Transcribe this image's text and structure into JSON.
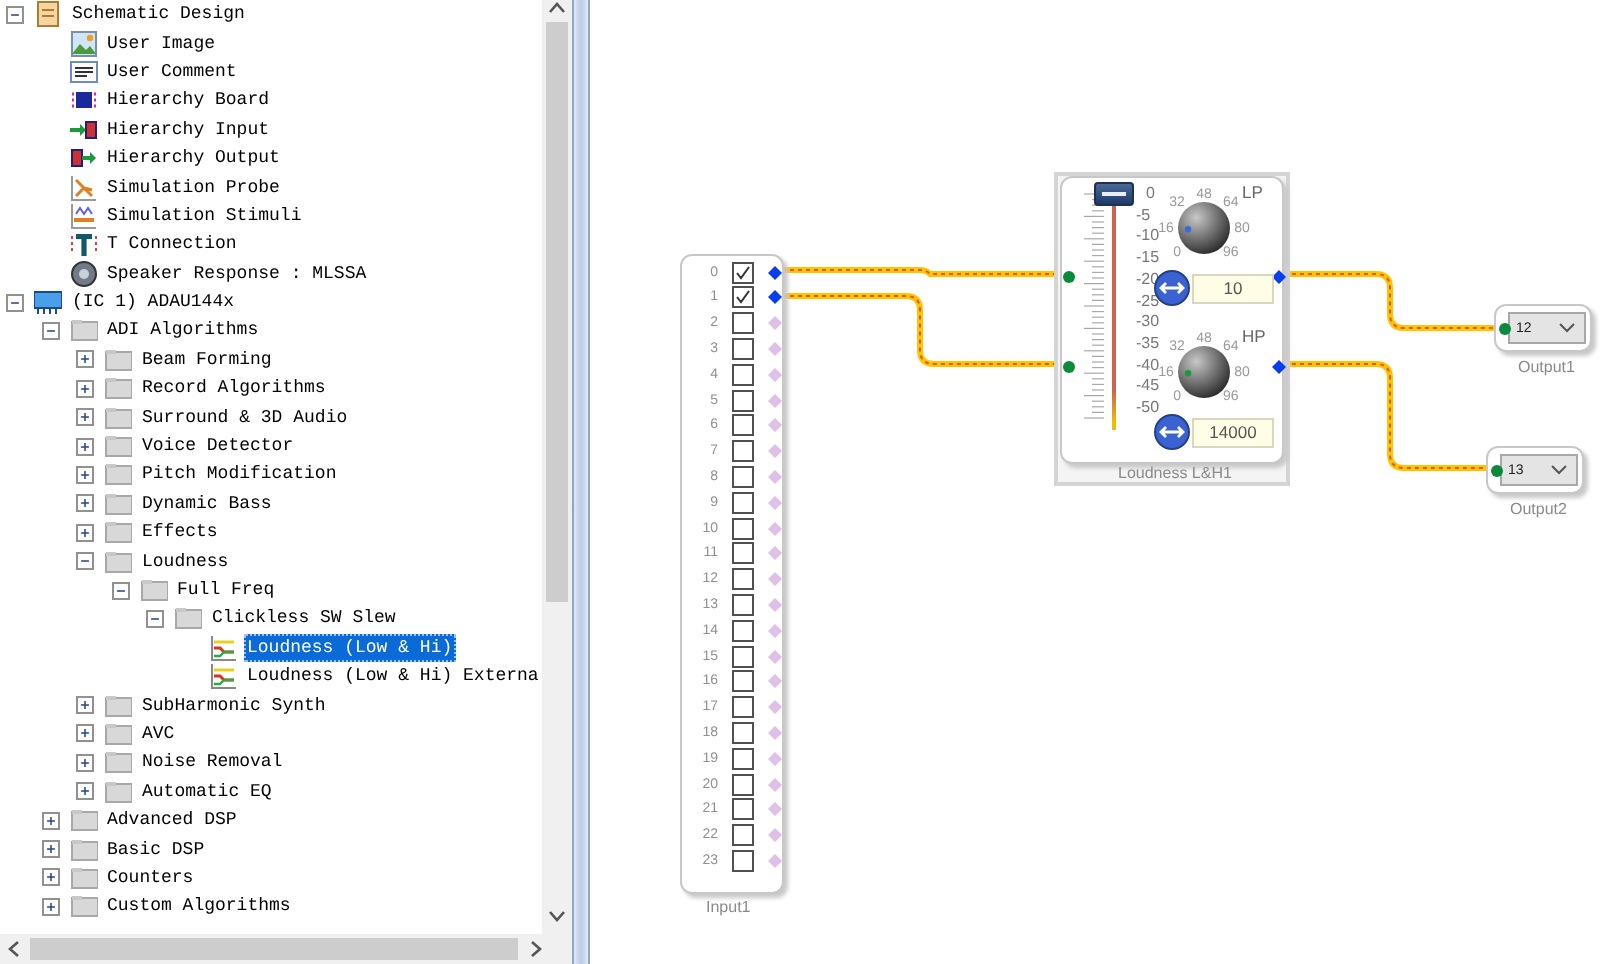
{
  "tree": [
    {
      "label": "Schematic Design",
      "kind": "schematic",
      "expanded": true,
      "selected": false,
      "children": [
        {
          "label": "User Image",
          "kind": "image",
          "selected": false
        },
        {
          "label": "User Comment",
          "kind": "comment",
          "selected": false
        },
        {
          "label": "Hierarchy Board",
          "kind": "board",
          "selected": false
        },
        {
          "label": "Hierarchy Input",
          "kind": "input",
          "selected": false
        },
        {
          "label": "Hierarchy Output",
          "kind": "output",
          "selected": false
        },
        {
          "label": "Simulation Probe",
          "kind": "probe",
          "selected": false
        },
        {
          "label": "Simulation Stimuli",
          "kind": "stimuli",
          "selected": false
        },
        {
          "label": "T Connection",
          "kind": "tconn",
          "selected": false
        },
        {
          "label": "Speaker Response : MLSSA",
          "kind": "speaker",
          "selected": false
        }
      ]
    },
    {
      "label": "(IC 1) ADAU144x",
      "kind": "chip",
      "expanded": true,
      "selected": false,
      "children": [
        {
          "label": "ADI Algorithms",
          "kind": "folder",
          "expanded": true,
          "selected": false,
          "children": [
            {
              "label": "Beam Forming",
              "kind": "folder",
              "expanded": false,
              "selected": false
            },
            {
              "label": "Record Algorithms",
              "kind": "folder",
              "expanded": false,
              "selected": false
            },
            {
              "label": "Surround & 3D Audio",
              "kind": "folder",
              "expanded": false,
              "selected": false
            },
            {
              "label": "Voice Detector",
              "kind": "folder",
              "expanded": false,
              "selected": false
            },
            {
              "label": "Pitch Modification",
              "kind": "folder",
              "expanded": false,
              "selected": false
            },
            {
              "label": "Dynamic Bass",
              "kind": "folder",
              "expanded": false,
              "selected": false
            },
            {
              "label": "Effects",
              "kind": "folder",
              "expanded": false,
              "selected": false
            },
            {
              "label": "Loudness",
              "kind": "folder",
              "expanded": true,
              "selected": false,
              "children": [
                {
                  "label": "Full Freq",
                  "kind": "folder",
                  "expanded": true,
                  "selected": false,
                  "children": [
                    {
                      "label": "Clickless SW Slew",
                      "kind": "folder",
                      "expanded": true,
                      "selected": false,
                      "children": [
                        {
                          "label": "Loudness (Low & Hi)",
                          "kind": "algorithm",
                          "selected": true
                        },
                        {
                          "label": "Loudness (Low & Hi) Externa",
                          "kind": "algorithm",
                          "selected": false
                        }
                      ]
                    }
                  ]
                }
              ]
            },
            {
              "label": "SubHarmonic Synth",
              "kind": "folder",
              "expanded": false,
              "selected": false
            },
            {
              "label": "AVC",
              "kind": "folder",
              "expanded": false,
              "selected": false
            },
            {
              "label": "Noise Removal",
              "kind": "folder",
              "expanded": false,
              "selected": false
            },
            {
              "label": "Automatic EQ",
              "kind": "folder",
              "expanded": false,
              "selected": false
            }
          ]
        },
        {
          "label": "Advanced DSP",
          "kind": "folder",
          "expanded": false,
          "selected": false
        },
        {
          "label": "Basic DSP",
          "kind": "folder",
          "expanded": false,
          "selected": false
        },
        {
          "label": "Counters",
          "kind": "folder",
          "expanded": false,
          "selected": false
        },
        {
          "label": "Custom Algorithms",
          "kind": "folder",
          "expanded": false,
          "selected": false
        }
      ]
    }
  ],
  "input_block": {
    "title": "Input1",
    "channels": [
      {
        "label": "0",
        "checked": true,
        "connected": true
      },
      {
        "label": "1",
        "checked": true,
        "connected": true
      },
      {
        "label": "2",
        "checked": false,
        "connected": false
      },
      {
        "label": "3",
        "checked": false,
        "connected": false
      },
      {
        "label": "4",
        "checked": false,
        "connected": false
      },
      {
        "label": "5",
        "checked": false,
        "connected": false
      },
      {
        "label": "6",
        "checked": false,
        "connected": false
      },
      {
        "label": "7",
        "checked": false,
        "connected": false
      },
      {
        "label": "8",
        "checked": false,
        "connected": false
      },
      {
        "label": "9",
        "checked": false,
        "connected": false
      },
      {
        "label": "10",
        "checked": false,
        "connected": false
      },
      {
        "label": "11",
        "checked": false,
        "connected": false
      },
      {
        "label": "12",
        "checked": false,
        "connected": false
      },
      {
        "label": "13",
        "checked": false,
        "connected": false
      },
      {
        "label": "14",
        "checked": false,
        "connected": false
      },
      {
        "label": "15",
        "checked": false,
        "connected": false
      },
      {
        "label": "16",
        "checked": false,
        "connected": false
      },
      {
        "label": "17",
        "checked": false,
        "connected": false
      },
      {
        "label": "18",
        "checked": false,
        "connected": false
      },
      {
        "label": "19",
        "checked": false,
        "connected": false
      },
      {
        "label": "20",
        "checked": false,
        "connected": false
      },
      {
        "label": "21",
        "checked": false,
        "connected": false
      },
      {
        "label": "22",
        "checked": false,
        "connected": false
      },
      {
        "label": "23",
        "checked": false,
        "connected": false
      }
    ]
  },
  "loudness_block": {
    "title": "Loudness L&H1",
    "slider": {
      "level": 1,
      "scale": [
        "0",
        "-5",
        "-10",
        "-15",
        "-20",
        "-25",
        "-30",
        "-35",
        "-40",
        "-45",
        "-50"
      ]
    },
    "knobs": [
      {
        "label": "LP",
        "scale": [
          "0",
          "16",
          "32",
          "48",
          "64",
          "80",
          "96"
        ],
        "value": "10"
      },
      {
        "label": "HP",
        "scale": [
          "0",
          "16",
          "32",
          "48",
          "64",
          "80",
          "96"
        ],
        "value": "14000"
      }
    ]
  },
  "outputs": [
    {
      "title": "Output1",
      "value": "12"
    },
    {
      "title": "Output2",
      "value": "13"
    }
  ]
}
